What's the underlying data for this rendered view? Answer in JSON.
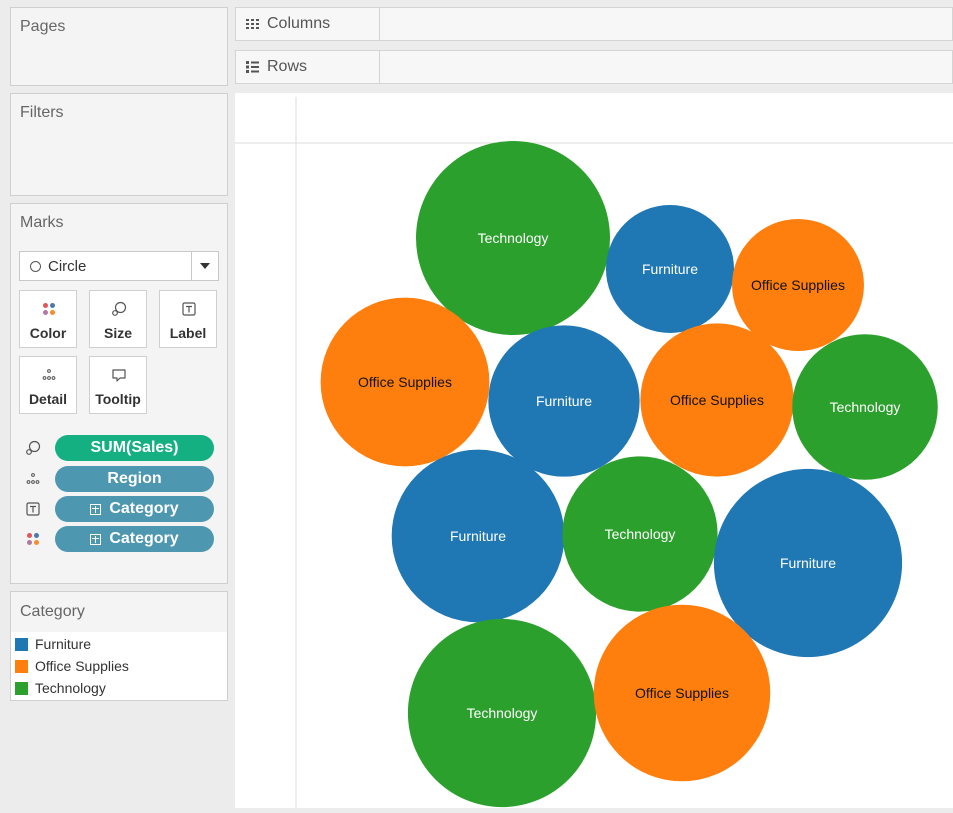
{
  "side": {
    "pages_title": "Pages",
    "filters_title": "Filters",
    "marks_title": "Marks",
    "mark_type": "Circle",
    "mark_buttons": {
      "color": "Color",
      "size": "Size",
      "label": "Label",
      "detail": "Detail",
      "tooltip": "Tooltip"
    },
    "pills": [
      {
        "label": "SUM(Sales)",
        "role": "size",
        "color": "#14b082"
      },
      {
        "label": "Region",
        "role": "detail",
        "color": "#4e97b0"
      },
      {
        "label": "Category",
        "role": "label",
        "color": "#4e97b0"
      },
      {
        "label": "Category",
        "role": "color",
        "color": "#4e97b0"
      }
    ]
  },
  "shelves": {
    "columns": "Columns",
    "rows": "Rows"
  },
  "legend": {
    "title": "Category",
    "items": [
      {
        "label": "Furniture",
        "color": "#1f77b4"
      },
      {
        "label": "Office Supplies",
        "color": "#ff7f0e"
      },
      {
        "label": "Technology",
        "color": "#2ca02c"
      }
    ]
  },
  "chart_data": {
    "type": "packed-bubble",
    "color_by": "Category",
    "size_by": "SUM(Sales)",
    "detail_by": "Region",
    "bubbles": [
      {
        "category": "Technology",
        "relative_size": 1.0
      },
      {
        "category": "Furniture",
        "relative_size": 0.66
      },
      {
        "category": "Office Supplies",
        "relative_size": 0.68
      },
      {
        "category": "Office Supplies",
        "relative_size": 0.87
      },
      {
        "category": "Furniture",
        "relative_size": 0.78
      },
      {
        "category": "Office Supplies",
        "relative_size": 0.79
      },
      {
        "category": "Technology",
        "relative_size": 0.75
      },
      {
        "category": "Furniture",
        "relative_size": 0.89
      },
      {
        "category": "Technology",
        "relative_size": 0.8
      },
      {
        "category": "Furniture",
        "relative_size": 0.97
      },
      {
        "category": "Technology",
        "relative_size": 0.97
      },
      {
        "category": "Office Supplies",
        "relative_size": 0.91
      }
    ]
  }
}
